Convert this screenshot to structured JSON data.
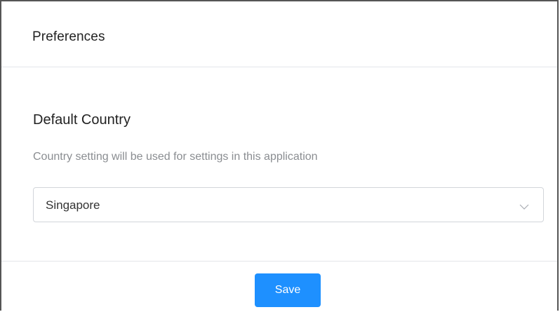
{
  "header": {
    "title": "Preferences"
  },
  "section": {
    "title": "Default Country",
    "description": "Country setting will be used for settings in this application"
  },
  "country_select": {
    "value": "Singapore",
    "icon": "chevron-down-icon"
  },
  "footer": {
    "save_label": "Save"
  },
  "colors": {
    "accent": "#1e90ff",
    "border": "#d2d5da",
    "muted_text": "#8a8d91"
  }
}
